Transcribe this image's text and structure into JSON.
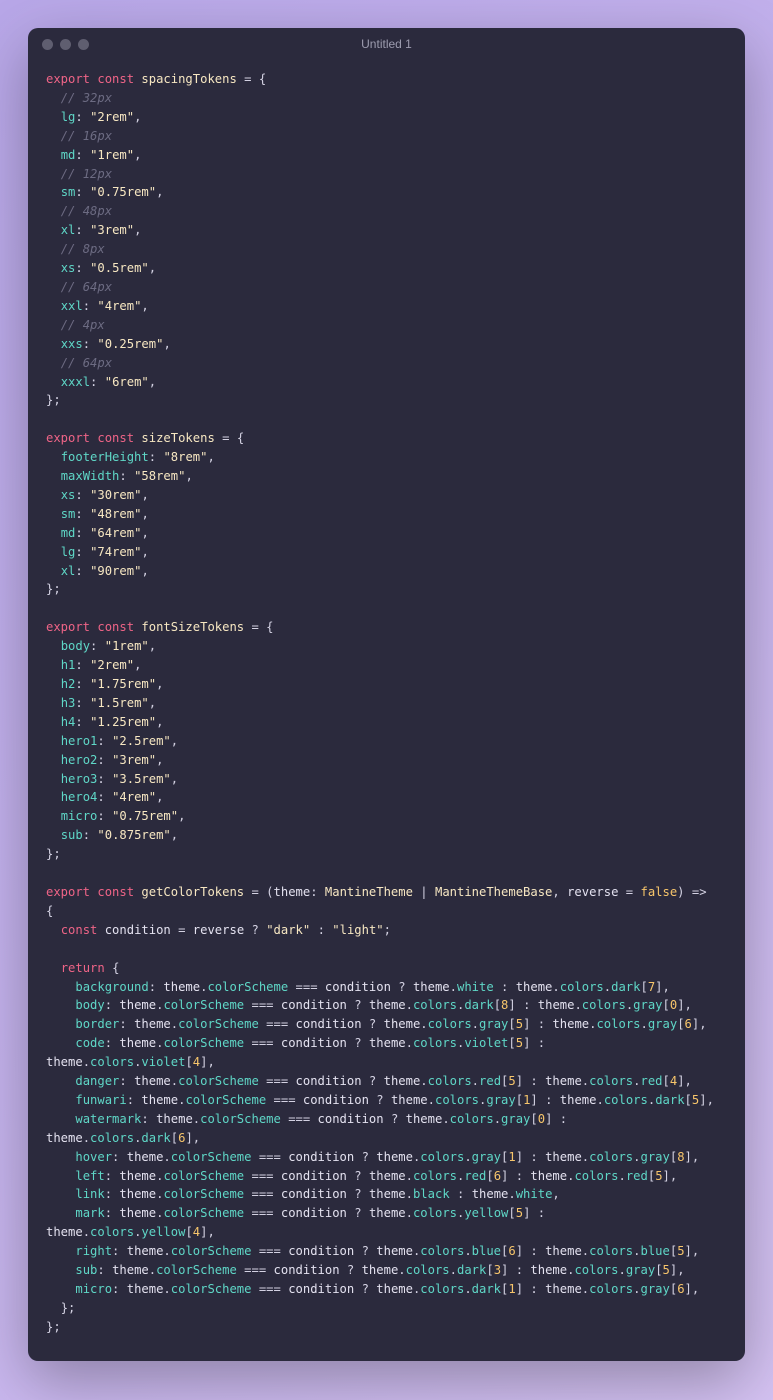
{
  "window": {
    "title": "Untitled 1"
  },
  "spacing": {
    "c_lg": "// 32px",
    "lg": "\"2rem\"",
    "c_md": "// 16px",
    "md": "\"1rem\"",
    "c_sm": "// 12px",
    "sm": "\"0.75rem\"",
    "c_xl": "// 48px",
    "xl": "\"3rem\"",
    "c_xs": "// 8px",
    "xs": "\"0.5rem\"",
    "c_xxl": "// 64px",
    "xxl": "\"4rem\"",
    "c_xxs": "// 4px",
    "xxs": "\"0.25rem\"",
    "c_xxxl": "// 64px",
    "xxxl": "\"6rem\""
  },
  "size": {
    "footerHeight": "\"8rem\"",
    "maxWidth": "\"58rem\"",
    "xs": "\"30rem\"",
    "sm": "\"48rem\"",
    "md": "\"64rem\"",
    "lg": "\"74rem\"",
    "xl": "\"90rem\""
  },
  "font": {
    "body": "\"1rem\"",
    "h1": "\"2rem\"",
    "h2": "\"1.75rem\"",
    "h3": "\"1.5rem\"",
    "h4": "\"1.25rem\"",
    "hero1": "\"2.5rem\"",
    "hero2": "\"3rem\"",
    "hero3": "\"3.5rem\"",
    "hero4": "\"4rem\"",
    "micro": "\"0.75rem\"",
    "sub": "\"0.875rem\""
  },
  "fn": {
    "name": "getColorTokens",
    "p1": "theme",
    "t1": "MantineTheme",
    "t2": "MantineThemeBase",
    "p2": "reverse",
    "def": "false",
    "cond_var": "condition",
    "cond_t": "\"dark\"",
    "cond_f": "\"light\"",
    "background": {
      "k": "background",
      "true": "white",
      "false": "dark",
      "fi": "7"
    },
    "body": {
      "k": "body",
      "a": "dark",
      "ai": "8",
      "b": "gray",
      "bi": "0"
    },
    "border": {
      "k": "border",
      "a": "gray",
      "ai": "5",
      "b": "gray",
      "bi": "6"
    },
    "code": {
      "k": "code",
      "a": "violet",
      "ai": "5",
      "b": "violet",
      "bi": "4"
    },
    "danger": {
      "k": "danger",
      "a": "red",
      "ai": "5",
      "b": "red",
      "bi": "4"
    },
    "funwari": {
      "k": "funwari",
      "a": "gray",
      "ai": "1",
      "b": "dark",
      "bi": "5"
    },
    "watermark": {
      "k": "watermark",
      "a": "gray",
      "ai": "0",
      "b": "dark",
      "bi": "6"
    },
    "hover": {
      "k": "hover",
      "a": "gray",
      "ai": "1",
      "b": "gray",
      "bi": "8"
    },
    "left": {
      "k": "left",
      "a": "red",
      "ai": "6",
      "b": "red",
      "bi": "5"
    },
    "link": {
      "k": "link",
      "a": "black",
      "b": "white"
    },
    "mark": {
      "k": "mark",
      "a": "yellow",
      "ai": "5",
      "b": "yellow",
      "bi": "4"
    },
    "right": {
      "k": "right",
      "a": "blue",
      "ai": "6",
      "b": "blue",
      "bi": "5"
    },
    "sub": {
      "k": "sub",
      "a": "dark",
      "ai": "3",
      "b": "gray",
      "bi": "5"
    },
    "micro": {
      "k": "micro",
      "a": "dark",
      "ai": "1",
      "b": "gray",
      "bi": "6"
    }
  }
}
